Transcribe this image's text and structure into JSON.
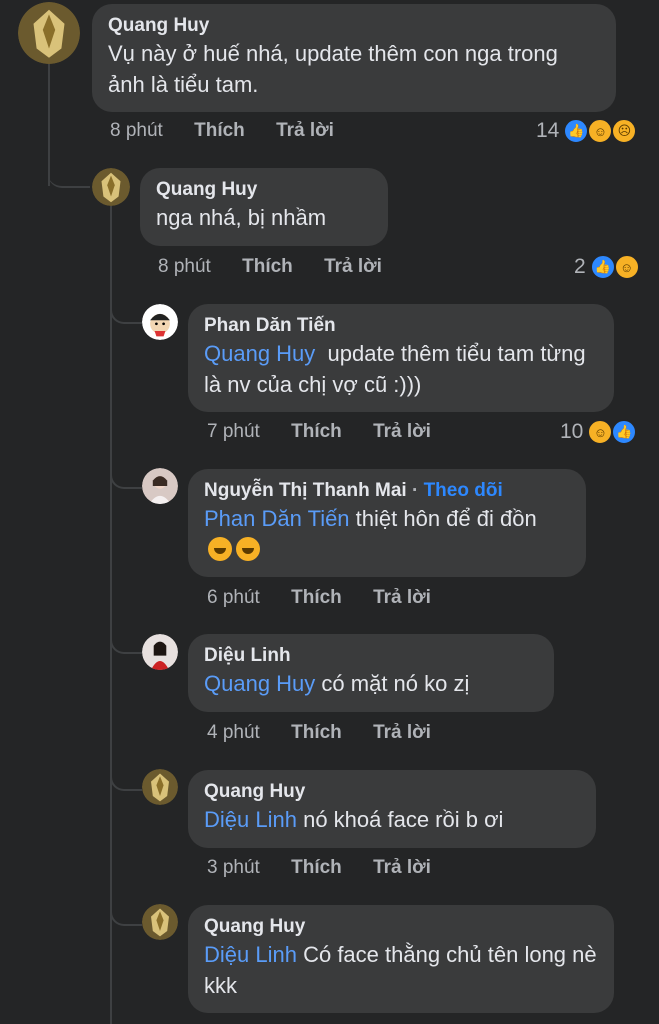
{
  "actions": {
    "like": "Thích",
    "reply": "Trả lời"
  },
  "comments": [
    {
      "name": "Quang Huy",
      "text": "Vụ này ở huế nhá, update thêm con nga trong ảnh là tiểu tam.",
      "time": "8 phút",
      "react_count": "14"
    },
    {
      "name": "Quang Huy",
      "text": "nga nhá, bị nhầm",
      "time": "8 phút",
      "react_count": "2"
    },
    {
      "name": "Phan Dăn Tiến",
      "mention": "Quang Huy",
      "text": "update thêm tiểu tam từng là nv của chị vợ cũ :)))",
      "time": "7 phút",
      "react_count": "10"
    },
    {
      "name": "Nguyễn Thị Thanh Mai",
      "dot": "·",
      "follow": "Theo dõi",
      "mention": "Phan Dăn Tiến",
      "text": "thiệt hôn để đi đồn",
      "time": "6 phút"
    },
    {
      "name": "Diệu Linh",
      "mention": "Quang Huy",
      "text": "có mặt nó ko zị",
      "time": "4 phút"
    },
    {
      "name": "Quang Huy",
      "mention": "Diệu Linh",
      "text": "nó khoá face rồi b ơi",
      "time": "3 phút"
    },
    {
      "name": "Quang Huy",
      "mention": "Diệu Linh",
      "text": "Có face thằng chủ tên long nè kkk"
    }
  ],
  "icons": {
    "like": "like-icon",
    "haha": "haha-icon",
    "sad": "sad-icon",
    "sweat_smile": "sweat-smile-emoji"
  }
}
